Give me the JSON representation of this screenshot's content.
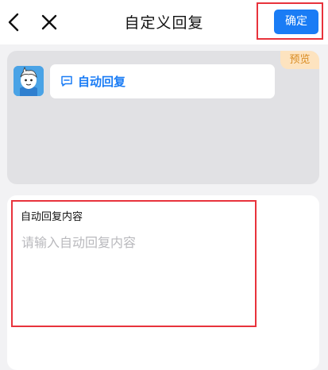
{
  "header": {
    "title": "自定义回复",
    "confirm_label": "确定",
    "back_icon": "chevron-left-icon",
    "close_icon": "close-icon"
  },
  "preview": {
    "tag": "预览",
    "reply_label": "自动回复",
    "reply_icon": "message-square-icon"
  },
  "content": {
    "label": "自动回复内容",
    "placeholder": "请输入自动回复内容",
    "value": ""
  },
  "colors": {
    "accent": "#1a7cf5",
    "highlight": "#e8333c",
    "preview_tag_bg": "#fde3bf",
    "preview_tag_text": "#d98c23"
  }
}
